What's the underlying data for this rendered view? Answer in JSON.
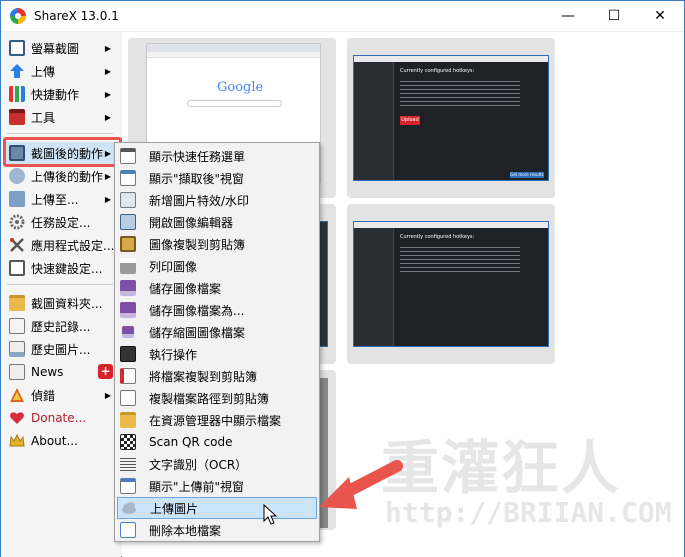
{
  "window": {
    "title": "ShareX 13.0.1",
    "minimize": "—",
    "maximize": "☐",
    "close": "✕"
  },
  "left_menu": {
    "items": [
      {
        "label": "螢幕截圖",
        "icon": "capture-icon",
        "submenu": true
      },
      {
        "label": "上傳",
        "icon": "upload-arrow-icon",
        "submenu": true
      },
      {
        "label": "快捷動作",
        "icon": "workflow-grid-icon",
        "submenu": true
      },
      {
        "label": "工具",
        "icon": "toolbox-icon",
        "submenu": true
      },
      {
        "label": "截圖後的動作",
        "icon": "after-capture-icon",
        "submenu": true
      },
      {
        "label": "上傳後的動作",
        "icon": "after-upload-icon",
        "submenu": true
      },
      {
        "label": "上傳至...",
        "icon": "destinations-icon",
        "submenu": true
      },
      {
        "label": "任務設定...",
        "icon": "gear-icon",
        "submenu": false
      },
      {
        "label": "應用程式設定...",
        "icon": "wrench-icon",
        "submenu": false
      },
      {
        "label": "快速鍵設定...",
        "icon": "keyboard-icon",
        "submenu": false
      },
      {
        "label": "截圖資料夾...",
        "icon": "folder-icon",
        "submenu": false
      },
      {
        "label": "歷史記錄...",
        "icon": "history-icon",
        "submenu": false
      },
      {
        "label": "歷史圖片...",
        "icon": "image-history-icon",
        "submenu": false
      },
      {
        "label": "News",
        "icon": "news-icon",
        "submenu": false,
        "badge": "+"
      },
      {
        "label": "偵錯",
        "icon": "debug-icon",
        "submenu": true
      },
      {
        "label": "Donate...",
        "icon": "heart-icon",
        "submenu": false
      },
      {
        "label": "About...",
        "icon": "crown-icon",
        "submenu": false
      }
    ]
  },
  "context_menu": {
    "items": [
      {
        "label": "顯示快速任務選單",
        "icon": "quick-task-icon"
      },
      {
        "label": "顯示\"擷取後\"視窗",
        "icon": "after-capture-window-icon"
      },
      {
        "label": "新增圖片特效/水印",
        "icon": "image-effects-icon"
      },
      {
        "label": "開啟圖像編輯器",
        "icon": "image-editor-icon"
      },
      {
        "label": "圖像複製到剪貼簿",
        "icon": "copy-image-icon"
      },
      {
        "label": "列印圖像",
        "icon": "printer-icon"
      },
      {
        "label": "儲存圖像檔案",
        "icon": "save-icon"
      },
      {
        "label": "儲存圖像檔案為...",
        "icon": "save-as-icon"
      },
      {
        "label": "儲存縮圖圖像檔案",
        "icon": "save-thumbnail-icon"
      },
      {
        "label": "執行操作",
        "icon": "terminal-icon"
      },
      {
        "label": "將檔案複製到剪貼簿",
        "icon": "copy-file-icon"
      },
      {
        "label": "複製檔案路徑到剪貼簿",
        "icon": "copy-path-icon"
      },
      {
        "label": "在資源管理器中顯示檔案",
        "icon": "explorer-folder-icon"
      },
      {
        "label": "Scan QR code",
        "icon": "qr-code-icon"
      },
      {
        "label": "文字識別（OCR）",
        "icon": "ocr-icon"
      },
      {
        "label": "顯示\"上傳前\"視窗",
        "icon": "before-upload-window-icon"
      },
      {
        "label": "上傳圖片",
        "icon": "upload-cloud-icon",
        "selected": true
      },
      {
        "label": "刪除本地檔案",
        "icon": "delete-file-icon"
      }
    ]
  },
  "thumbnail_text": {
    "google": "Google",
    "hotkeys_heading": "Currently configured hotkeys:",
    "upload_button": "Upload",
    "link_text": "Get more results"
  },
  "watermark": {
    "big": "重灌狂人",
    "url": "http://BRIIAN.COM"
  },
  "colors": {
    "highlight": "#e9554c",
    "selection": "#cce4f7",
    "accent": "#3b7cc9"
  }
}
